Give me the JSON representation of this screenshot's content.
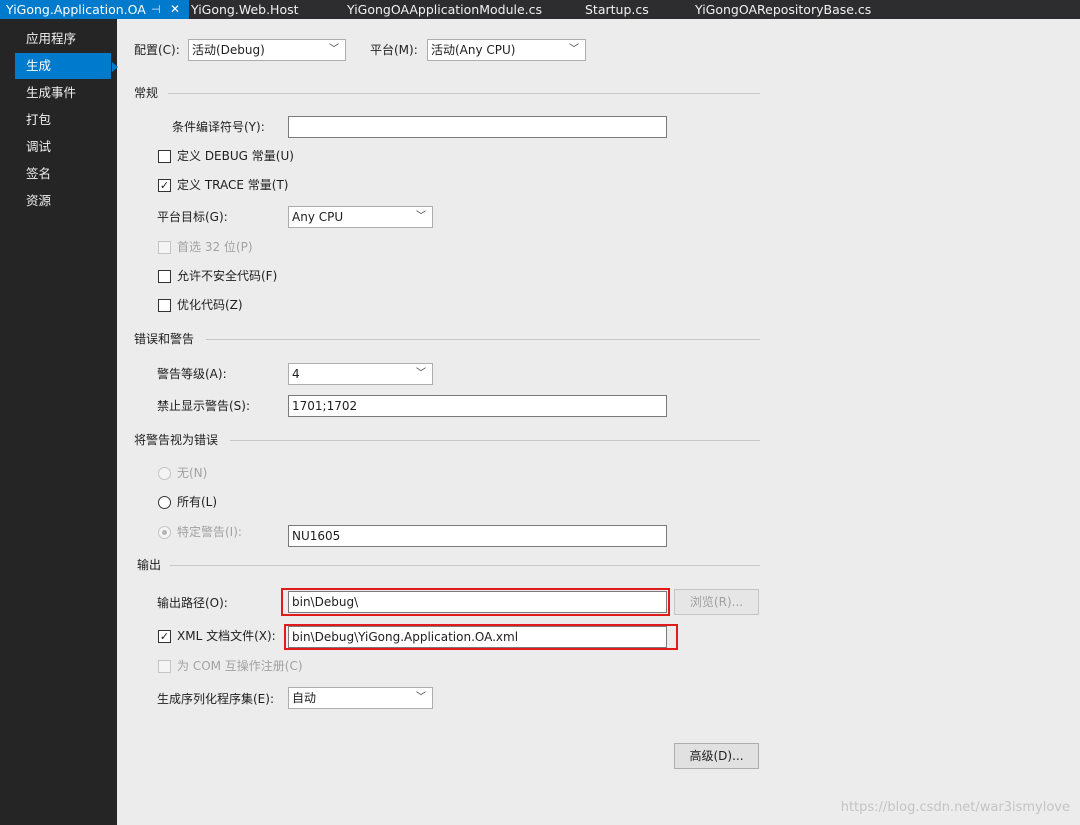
{
  "tabs": [
    {
      "label": "YiGong.Application.OA",
      "active": true,
      "pin": "⊣",
      "close": "✕"
    },
    {
      "label": "YiGong.Web.Host"
    },
    {
      "label": "YiGongOAApplicationModule.cs"
    },
    {
      "label": "Startup.cs"
    },
    {
      "label": "YiGongOARepositoryBase.cs"
    }
  ],
  "sidebar": {
    "items": [
      {
        "label": "应用程序"
      },
      {
        "label": "生成",
        "active": true
      },
      {
        "label": "生成事件"
      },
      {
        "label": "打包"
      },
      {
        "label": "调试"
      },
      {
        "label": "签名"
      },
      {
        "label": "资源"
      }
    ]
  },
  "top": {
    "config_label": "配置(C):",
    "config_value": "活动(Debug)",
    "platform_label": "平台(M):",
    "platform_value": "活动(Any CPU)"
  },
  "general": {
    "heading": "常规",
    "cond_symbols_label": "条件编译符号(Y):",
    "cond_symbols_value": "",
    "define_debug_label": "定义 DEBUG 常量(U)",
    "define_debug_checked": false,
    "define_trace_label": "定义 TRACE 常量(T)",
    "define_trace_checked": true,
    "platform_target_label": "平台目标(G):",
    "platform_target_value": "Any CPU",
    "prefer32_label": "首选 32 位(P)",
    "unsafe_label": "允许不安全代码(F)",
    "optimize_label": "优化代码(Z)"
  },
  "errors": {
    "heading": "错误和警告",
    "warning_level_label": "警告等级(A):",
    "warning_level_value": "4",
    "suppress_label": "禁止显示警告(S):",
    "suppress_value": "1701;1702"
  },
  "treat_warnings": {
    "heading": "将警告视为错误",
    "none_label": "无(N)",
    "all_label": "所有(L)",
    "specific_label": "特定警告(I):",
    "specific_value": "NU1605"
  },
  "output": {
    "heading": "输出",
    "path_label": "输出路径(O):",
    "path_value": "bin\\Debug\\",
    "browse_label": "浏览(R)...",
    "xml_label": "XML 文档文件(X):",
    "xml_checked": true,
    "xml_value": "bin\\Debug\\YiGong.Application.OA.xml",
    "com_label": "为 COM 互操作注册(C)",
    "serialization_label": "生成序列化程序集(E):",
    "serialization_value": "自动",
    "advanced_label": "高级(D)..."
  },
  "watermark": "https://blog.csdn.net/war3ismylove",
  "colors": {
    "accent": "#007acc",
    "highlight": "#e01b1b",
    "sidebar_bg": "#252526",
    "content_bg": "#ececec"
  }
}
